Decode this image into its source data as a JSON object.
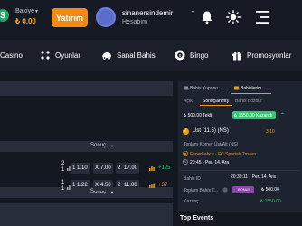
{
  "header": {
    "balance_label": "Bakiye",
    "balance_value": "₺ 0.00",
    "deposit_label": "Yatırım",
    "username": "sinanersindemir",
    "account_label": "Hesabım"
  },
  "nav": {
    "items": [
      {
        "label": "Casino",
        "icon": "casino-icon"
      },
      {
        "label": "Oyunlar",
        "icon": "games-icon"
      },
      {
        "label": "Sanal Bahis",
        "icon": "virtual-icon"
      },
      {
        "label": "Bingo",
        "icon": "bingo-icon"
      },
      {
        "label": "Promosyonlar",
        "icon": "gift-icon"
      }
    ]
  },
  "markets": {
    "section1": {
      "label": "Sonuç",
      "rows": [
        {
          "nums": [
            "2",
            "1"
          ],
          "odds": [
            {
              "key": "1",
              "value": "1.10"
            },
            {
              "key": "X",
              "value": "7.00"
            },
            {
              "key": "2",
              "value": "17.00"
            }
          ],
          "more": "+125"
        }
      ]
    },
    "section2": {
      "label": "Sonuç",
      "rows": [
        {
          "nums": [
            "1",
            "1"
          ],
          "odds": [
            {
              "key": "1",
              "value": "1.22"
            },
            {
              "key": "X",
              "value": "4.50"
            },
            {
              "key": "2",
              "value": "11.00"
            }
          ],
          "more": "+37"
        }
      ]
    }
  },
  "betslip": {
    "tabs": [
      "Bahis Kuponu",
      "Bahislerim"
    ],
    "subtabs": [
      "Açık",
      "Sonuçlanmış",
      "Bahis Bozdur"
    ],
    "stake_label": "₺ 500.00 Tekli",
    "win_label": "₺ 1550.00 Kazandı",
    "bet_name": "Üst (11.5) (NS)",
    "bet_odd": "3.10",
    "market": "Toplam Korner Üst/Alt (NS)",
    "teams": "Fenerbahce - FC Spartak Trnava",
    "time": "20:45 • Per. 14. Ara",
    "bet_id_label": "Bahis ID",
    "bet_date": "20:39:11 • Per. 14. Ara",
    "total_label": "Toplam Bahis T...",
    "bonus_label": "BONUS",
    "bonus_amount": "₺ 500.00",
    "payout_label": "Kazanç",
    "payout_amount": "₺ 1550.00"
  },
  "top_events_label": "Top Events",
  "colors": {
    "accent": "#f08a12",
    "win": "#2ecc71",
    "background": "#141821"
  }
}
